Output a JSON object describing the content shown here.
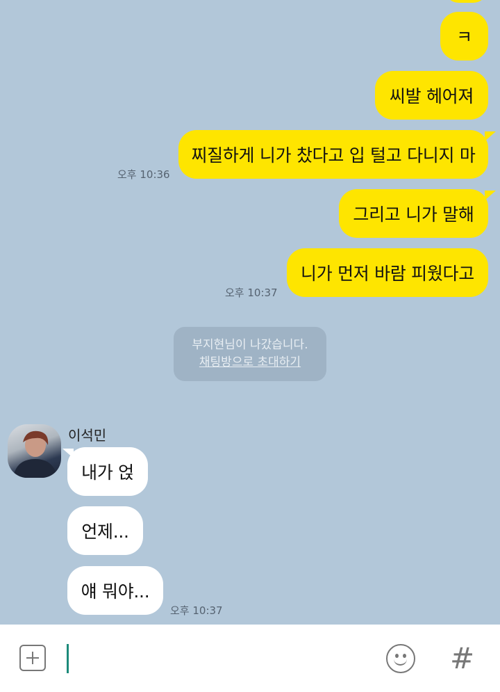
{
  "messages_out": [
    {
      "text": "ㅋ"
    },
    {
      "text": "씨발 헤어져"
    },
    {
      "text": "찌질하게 니가 찼다고 입 털고 다니지 마",
      "time": "오후 10:36"
    },
    {
      "text": "그리고 니가 말해"
    },
    {
      "text": "니가 먼저 바람 피웠다고",
      "time": "오후 10:37"
    }
  ],
  "notice": {
    "text": "부지현님이 나갔습니다.",
    "link": "채팅방으로 초대하기"
  },
  "sender": {
    "name": "이석민"
  },
  "messages_in": [
    {
      "text": "내가 얹"
    },
    {
      "text": "언제..."
    },
    {
      "text": "얘 뭐야...",
      "time": "오후 10:37"
    }
  ],
  "input": {
    "value": "",
    "placeholder": ""
  },
  "icons": {
    "attach": "plus-square-icon",
    "emoji": "smiley-icon",
    "hashtag": "hashtag-icon"
  },
  "colors": {
    "background": "#b2c7d9",
    "my_bubble": "#fee500",
    "their_bubble": "#ffffff",
    "caret": "#1c8a7a"
  }
}
